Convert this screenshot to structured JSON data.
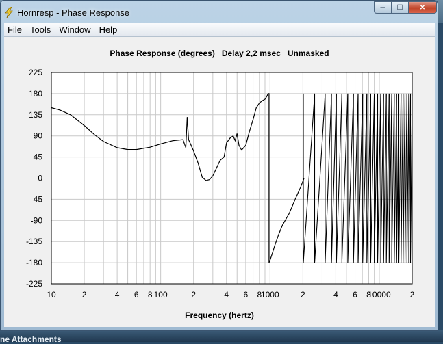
{
  "window": {
    "title": "Hornresp - Phase Response",
    "controls": {
      "minimize": "─",
      "maximize": "☐",
      "close": "✕"
    }
  },
  "menu": {
    "items": [
      "File",
      "Tools",
      "Window",
      "Help"
    ]
  },
  "desktop": {
    "bottom_text": "ne Attachments"
  },
  "colors": {
    "plot_bg": "#ffffff",
    "grid": "#c8c8c8",
    "trace": "#000000",
    "window_bg": "#f0f0f0"
  },
  "chart_data": {
    "type": "line",
    "title": "Phase Response (degrees)   Delay 2,2 msec   Unmasked",
    "xlabel": "Frequency (hertz)",
    "ylabel": "",
    "x_scale": "log",
    "xlim": [
      10,
      20000
    ],
    "ylim": [
      -225,
      225
    ],
    "grid": true,
    "x_tick_labels": [
      {
        "value": 10,
        "label": "10"
      },
      {
        "value": 20,
        "label": "2"
      },
      {
        "value": 40,
        "label": "4"
      },
      {
        "value": 60,
        "label": "6"
      },
      {
        "value": 80,
        "label": "8"
      },
      {
        "value": 100,
        "label": "100"
      },
      {
        "value": 200,
        "label": "2"
      },
      {
        "value": 400,
        "label": "4"
      },
      {
        "value": 600,
        "label": "6"
      },
      {
        "value": 800,
        "label": "8"
      },
      {
        "value": 1000,
        "label": "1000"
      },
      {
        "value": 2000,
        "label": "2"
      },
      {
        "value": 4000,
        "label": "4"
      },
      {
        "value": 6000,
        "label": "6"
      },
      {
        "value": 8000,
        "label": "8"
      },
      {
        "value": 10000,
        "label": "10000"
      },
      {
        "value": 20000,
        "label": "2"
      }
    ],
    "y_ticks": [
      225,
      180,
      135,
      90,
      45,
      0,
      -45,
      -90,
      -135,
      -180,
      -225
    ],
    "series": [
      {
        "x": [
          10,
          12,
          15,
          20,
          25,
          30,
          40,
          50,
          60,
          80,
          100,
          130,
          160,
          170,
          175,
          180,
          185,
          190,
          200,
          220,
          240,
          260,
          280,
          300,
          350,
          380,
          400,
          430,
          460,
          480,
          500,
          520,
          550,
          600,
          650,
          700,
          750,
          800,
          850,
          900,
          940,
          960,
          980,
          1000,
          1050,
          1100,
          1200,
          1300,
          1500,
          1700,
          1900,
          2050
        ],
        "y": [
          150,
          145,
          135,
          112,
          92,
          78,
          65,
          61,
          61,
          66,
          73,
          80,
          82,
          65,
          130,
          82,
          76,
          70,
          58,
          32,
          2,
          -5,
          -3,
          5,
          38,
          45,
          75,
          85,
          90,
          80,
          95,
          70,
          60,
          70,
          100,
          125,
          150,
          160,
          165,
          168,
          175,
          180,
          -180,
          -175,
          -160,
          -145,
          -120,
          -100,
          -75,
          -45,
          -20,
          0
        ]
      }
    ],
    "wrap_segments": [
      {
        "x_start": 2020,
        "x_end": 2560
      },
      {
        "x_start": 2560,
        "x_end": 3200
      },
      {
        "x_start": 3200,
        "x_end": 3650
      },
      {
        "x_start": 3650,
        "x_end": 4050
      },
      {
        "x_start": 4050,
        "x_end": 4550
      },
      {
        "x_start": 4550,
        "x_end": 5150
      },
      {
        "x_start": 5150,
        "x_end": 5800
      },
      {
        "x_start": 5800,
        "x_end": 6400
      },
      {
        "x_start": 6400,
        "x_end": 7050
      },
      {
        "x_start": 7050,
        "x_end": 7700
      },
      {
        "x_start": 7700,
        "x_end": 8350
      },
      {
        "x_start": 8350,
        "x_end": 9000
      },
      {
        "x_start": 9000,
        "x_end": 9650
      },
      {
        "x_start": 9650,
        "x_end": 10300
      },
      {
        "x_start": 10300,
        "x_end": 10950
      },
      {
        "x_start": 10950,
        "x_end": 11600
      },
      {
        "x_start": 11600,
        "x_end": 12300
      },
      {
        "x_start": 12300,
        "x_end": 13000
      },
      {
        "x_start": 13000,
        "x_end": 13700
      },
      {
        "x_start": 13700,
        "x_end": 14400
      },
      {
        "x_start": 14400,
        "x_end": 15100
      },
      {
        "x_start": 15100,
        "x_end": 15800
      },
      {
        "x_start": 15800,
        "x_end": 16500
      },
      {
        "x_start": 16500,
        "x_end": 17200
      },
      {
        "x_start": 17200,
        "x_end": 17900
      },
      {
        "x_start": 17900,
        "x_end": 18600
      },
      {
        "x_start": 18600,
        "x_end": 19300
      },
      {
        "x_start": 19300,
        "x_end": 20000
      }
    ]
  }
}
